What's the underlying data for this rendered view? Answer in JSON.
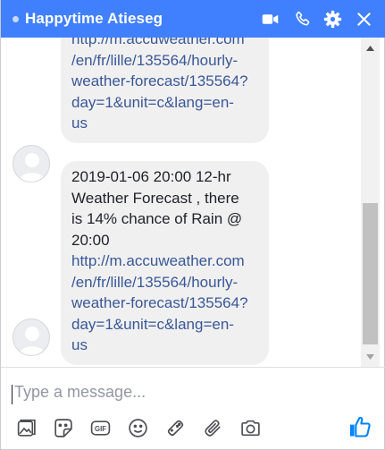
{
  "header": {
    "title": "Happytime Atieseg",
    "icons": [
      "video-camera-icon",
      "phone-icon",
      "gear-icon",
      "close-icon"
    ],
    "background": "#4080ff"
  },
  "messages": [
    {
      "lines": [
        {
          "text": "http://m.accuweather.com",
          "link": true
        },
        {
          "text": "/en/fr/lille/135564/hourly-",
          "link": true
        },
        {
          "text": "weather-forecast/135564?",
          "link": true
        },
        {
          "text": "day=1&unit=c&lang=en-",
          "link": true
        },
        {
          "text": "us",
          "link": true
        }
      ]
    },
    {
      "lines": [
        {
          "text": "2019-01-06 20:00 12-hr",
          "link": false
        },
        {
          "text": "Weather Forecast , there",
          "link": false
        },
        {
          "text": "is 14% chance of Rain @",
          "link": false
        },
        {
          "text": "20:00",
          "link": false
        },
        {
          "text": "http://m.accuweather.com",
          "link": true
        },
        {
          "text": "/en/fr/lille/135564/hourly-",
          "link": true
        },
        {
          "text": "weather-forecast/135564?",
          "link": true
        },
        {
          "text": "day=1&unit=c&lang=en-",
          "link": true
        },
        {
          "text": "us",
          "link": true
        }
      ]
    }
  ],
  "composer": {
    "placeholder": "Type a message..."
  },
  "toolbar": {
    "icons": [
      "photo-icon",
      "sticker-icon",
      "gif-icon",
      "emoji-icon",
      "game-icon",
      "attachment-icon",
      "camera-icon",
      "like-icon"
    ],
    "gif_label": "GIF"
  },
  "colors": {
    "accent": "#4080ff",
    "link": "#385898",
    "bubble": "#f1f0f0",
    "text": "#1d2129",
    "icon": "#4d4f54",
    "like": "#0084ff"
  }
}
